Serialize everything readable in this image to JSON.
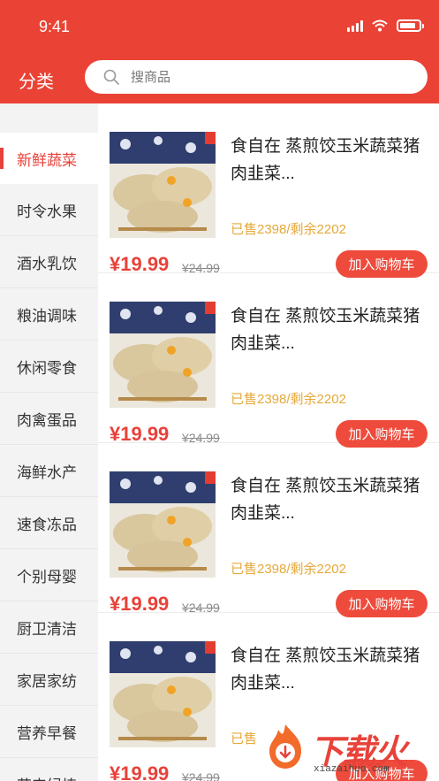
{
  "status_bar": {
    "time": "9:41"
  },
  "header": {
    "title": "分类",
    "search_placeholder": "搜商品"
  },
  "sidebar": {
    "items": [
      {
        "label": "新鲜蔬菜",
        "active": true
      },
      {
        "label": "时令水果"
      },
      {
        "label": "酒水乳饮"
      },
      {
        "label": "粮油调味"
      },
      {
        "label": "休闲零食"
      },
      {
        "label": "肉禽蛋品"
      },
      {
        "label": "海鲜水产"
      },
      {
        "label": "速食冻品"
      },
      {
        "label": "个别母婴"
      },
      {
        "label": "厨卫清洁"
      },
      {
        "label": "家居家纺"
      },
      {
        "label": "营养早餐"
      },
      {
        "label": "花卉绿植"
      }
    ]
  },
  "products": [
    {
      "name": "食自在 蒸煎饺玉米蔬菜猪肉韭菜...",
      "stock": "已售2398/剩余2202",
      "price": "¥19.99",
      "old_price": "¥24.99",
      "button": "加入购物车"
    },
    {
      "name": "食自在 蒸煎饺玉米蔬菜猪肉韭菜...",
      "stock": "已售2398/剩余2202",
      "price": "¥19.99",
      "old_price": "¥24.99",
      "button": "加入购物车"
    },
    {
      "name": "食自在 蒸煎饺玉米蔬菜猪肉韭菜...",
      "stock": "已售2398/剩余2202",
      "price": "¥19.99",
      "old_price": "¥24.99",
      "button": "加入购物车"
    },
    {
      "name": "食自在 蒸煎饺玉米蔬菜猪肉韭菜...",
      "stock": "已售",
      "price": "¥19.99",
      "old_price": "¥24.99",
      "button": "加入购物车"
    }
  ],
  "watermark": {
    "text": "下载火",
    "url": "xiazaihuo.com"
  },
  "colors": {
    "brand_red": "#ea4335",
    "stock_text": "#e5a83a",
    "sidebar_bg": "#f3f3f3"
  }
}
